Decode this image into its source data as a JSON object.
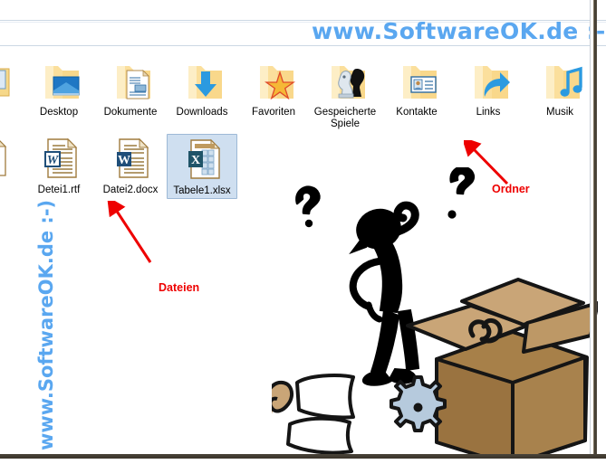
{
  "window": {
    "background_color": "#ffffff",
    "border_color": "#3a342a",
    "rule_color": "#ccd8e4"
  },
  "watermarks": {
    "top": "www.SoftwareOK.de :-)",
    "left": "www.SoftwareOK.de  :-)",
    "color": "#5aa7f0"
  },
  "folders": [
    {
      "name": "Desktop",
      "icon": "folder-desktop-icon"
    },
    {
      "name": "Dokumente",
      "icon": "folder-documents-icon"
    },
    {
      "name": "Downloads",
      "icon": "folder-downloads-icon"
    },
    {
      "name": "Favoriten",
      "icon": "folder-favorites-icon"
    },
    {
      "name": "Gespeicherte Spiele",
      "icon": "folder-saved-games-icon"
    },
    {
      "name": "Kontakte",
      "icon": "folder-contacts-icon"
    },
    {
      "name": "Links",
      "icon": "folder-links-icon"
    },
    {
      "name": "Musik",
      "icon": "folder-music-icon"
    }
  ],
  "files": [
    {
      "name": "Detei1.rtf",
      "icon": "word-rtf-file-icon",
      "selected": false
    },
    {
      "name": "Datei2.docx",
      "icon": "word-docx-file-icon",
      "selected": false
    },
    {
      "name": "Tabele1.xlsx",
      "icon": "excel-xlsx-file-icon",
      "selected": true
    }
  ],
  "annotations": [
    {
      "label": "Ordner",
      "color": "#ee0000",
      "points_to": "folder-musik"
    },
    {
      "label": "Dateien",
      "color": "#ee0000",
      "points_to": "file-row"
    }
  ],
  "illustration": {
    "name": "confused-stick-figure-with-box",
    "elements": [
      "question-mark-left",
      "question-mark-right",
      "stick-figure",
      "cardboard-box",
      "gear",
      "papers",
      "packing-tape"
    ],
    "colors": {
      "figure": "#000000",
      "box_light": "#c9a577",
      "box_dark": "#9c7b4c",
      "gear": "#b6cadd"
    }
  }
}
